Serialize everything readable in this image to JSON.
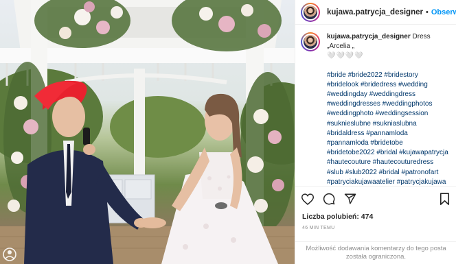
{
  "post": {
    "username": "kujawa.patrycja_designer",
    "follow_label": "Obserwuj",
    "separator": "•"
  },
  "caption": {
    "username": "kujawa.patrycja_designer",
    "text": "Dress „Arcelia „",
    "hearts": "🤍🤍🤍🤍",
    "hashtags": [
      "#bride",
      "#bride2022",
      "#bridestory",
      "#bridelook",
      "#bridedress",
      "#wedding",
      "#weddingday",
      "#weddingdress",
      "#weddingdresses",
      "#weddingphotos",
      "#weddingphoto",
      "#weddingsession",
      "#suknieslubne",
      "#sukniaslubna",
      "#bridaldress",
      "#pannamloda",
      "#pannamłoda",
      "#bridetobe",
      "#bridetobe2022",
      "#bridal",
      "#kujawapatrycja",
      "#hautecouture",
      "#hautecouturedress",
      "#slub",
      "#slub2022",
      "#bridal",
      "#patronofart",
      "#patryciakujawaatelier",
      "#patrycjakujawa"
    ]
  },
  "actions": {
    "like": "heart-icon",
    "comment": "comment-icon",
    "share": "share-icon",
    "save": "bookmark-icon"
  },
  "likes": {
    "label": "Liczba polubień:",
    "count": "474"
  },
  "time_ago": "46 MIN TEMU",
  "comments_restricted": "Możliwość dodawania komentarzy do tego posta została ograniczona.",
  "colors": {
    "link_blue": "#0095f6",
    "hashtag_blue": "#00376b",
    "muted": "#8e8e8e",
    "hair_red": "#e8222e"
  }
}
